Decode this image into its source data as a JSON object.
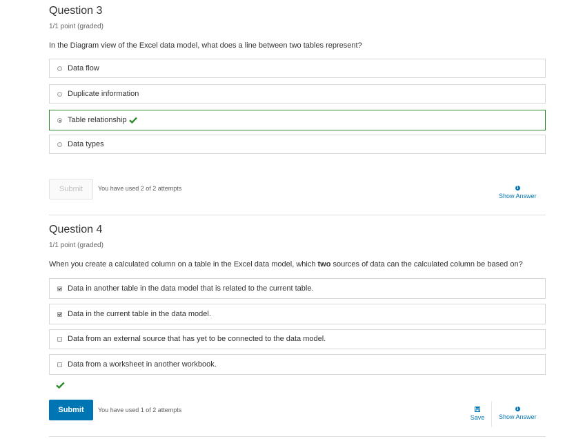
{
  "q3": {
    "title": "Question 3",
    "points": "1/1 point (graded)",
    "text": "In the Diagram view of the Excel data model, what does a line between two tables represent?",
    "choices": [
      {
        "label": "Data flow",
        "selected": false
      },
      {
        "label": "Duplicate information",
        "selected": false
      },
      {
        "label": "Table relationship",
        "selected": true,
        "correct": true
      },
      {
        "label": "Data types",
        "selected": false
      }
    ],
    "submit_label": "Submit",
    "attempts": "You have used 2 of 2 attempts",
    "show_answer": "Show Answer"
  },
  "q4": {
    "title": "Question 4",
    "points": "1/1 point (graded)",
    "text_before": "When you create a calculated column on a table in the Excel data model, which ",
    "text_bold": "two",
    "text_after": " sources of data can the calculated column be based on?",
    "choices": [
      {
        "label": "Data in another table in the data model that is related to the current table.",
        "checked": true
      },
      {
        "label": "Data in the current table in the data model.",
        "checked": true
      },
      {
        "label": "Data from an external source that has yet to be connected to the data model.",
        "checked": false
      },
      {
        "label": "Data from a worksheet in another workbook.",
        "checked": false
      }
    ],
    "submit_label": "Submit",
    "attempts": "You have used 1 of 2 attempts",
    "save": "Save",
    "show_answer": "Show Answer"
  },
  "colors": {
    "accent": "#0075b4",
    "correct": "#2b8a2b"
  },
  "icons": {
    "correct": "checkmark-icon",
    "info": "info-icon",
    "save": "floppy-disk-icon"
  }
}
